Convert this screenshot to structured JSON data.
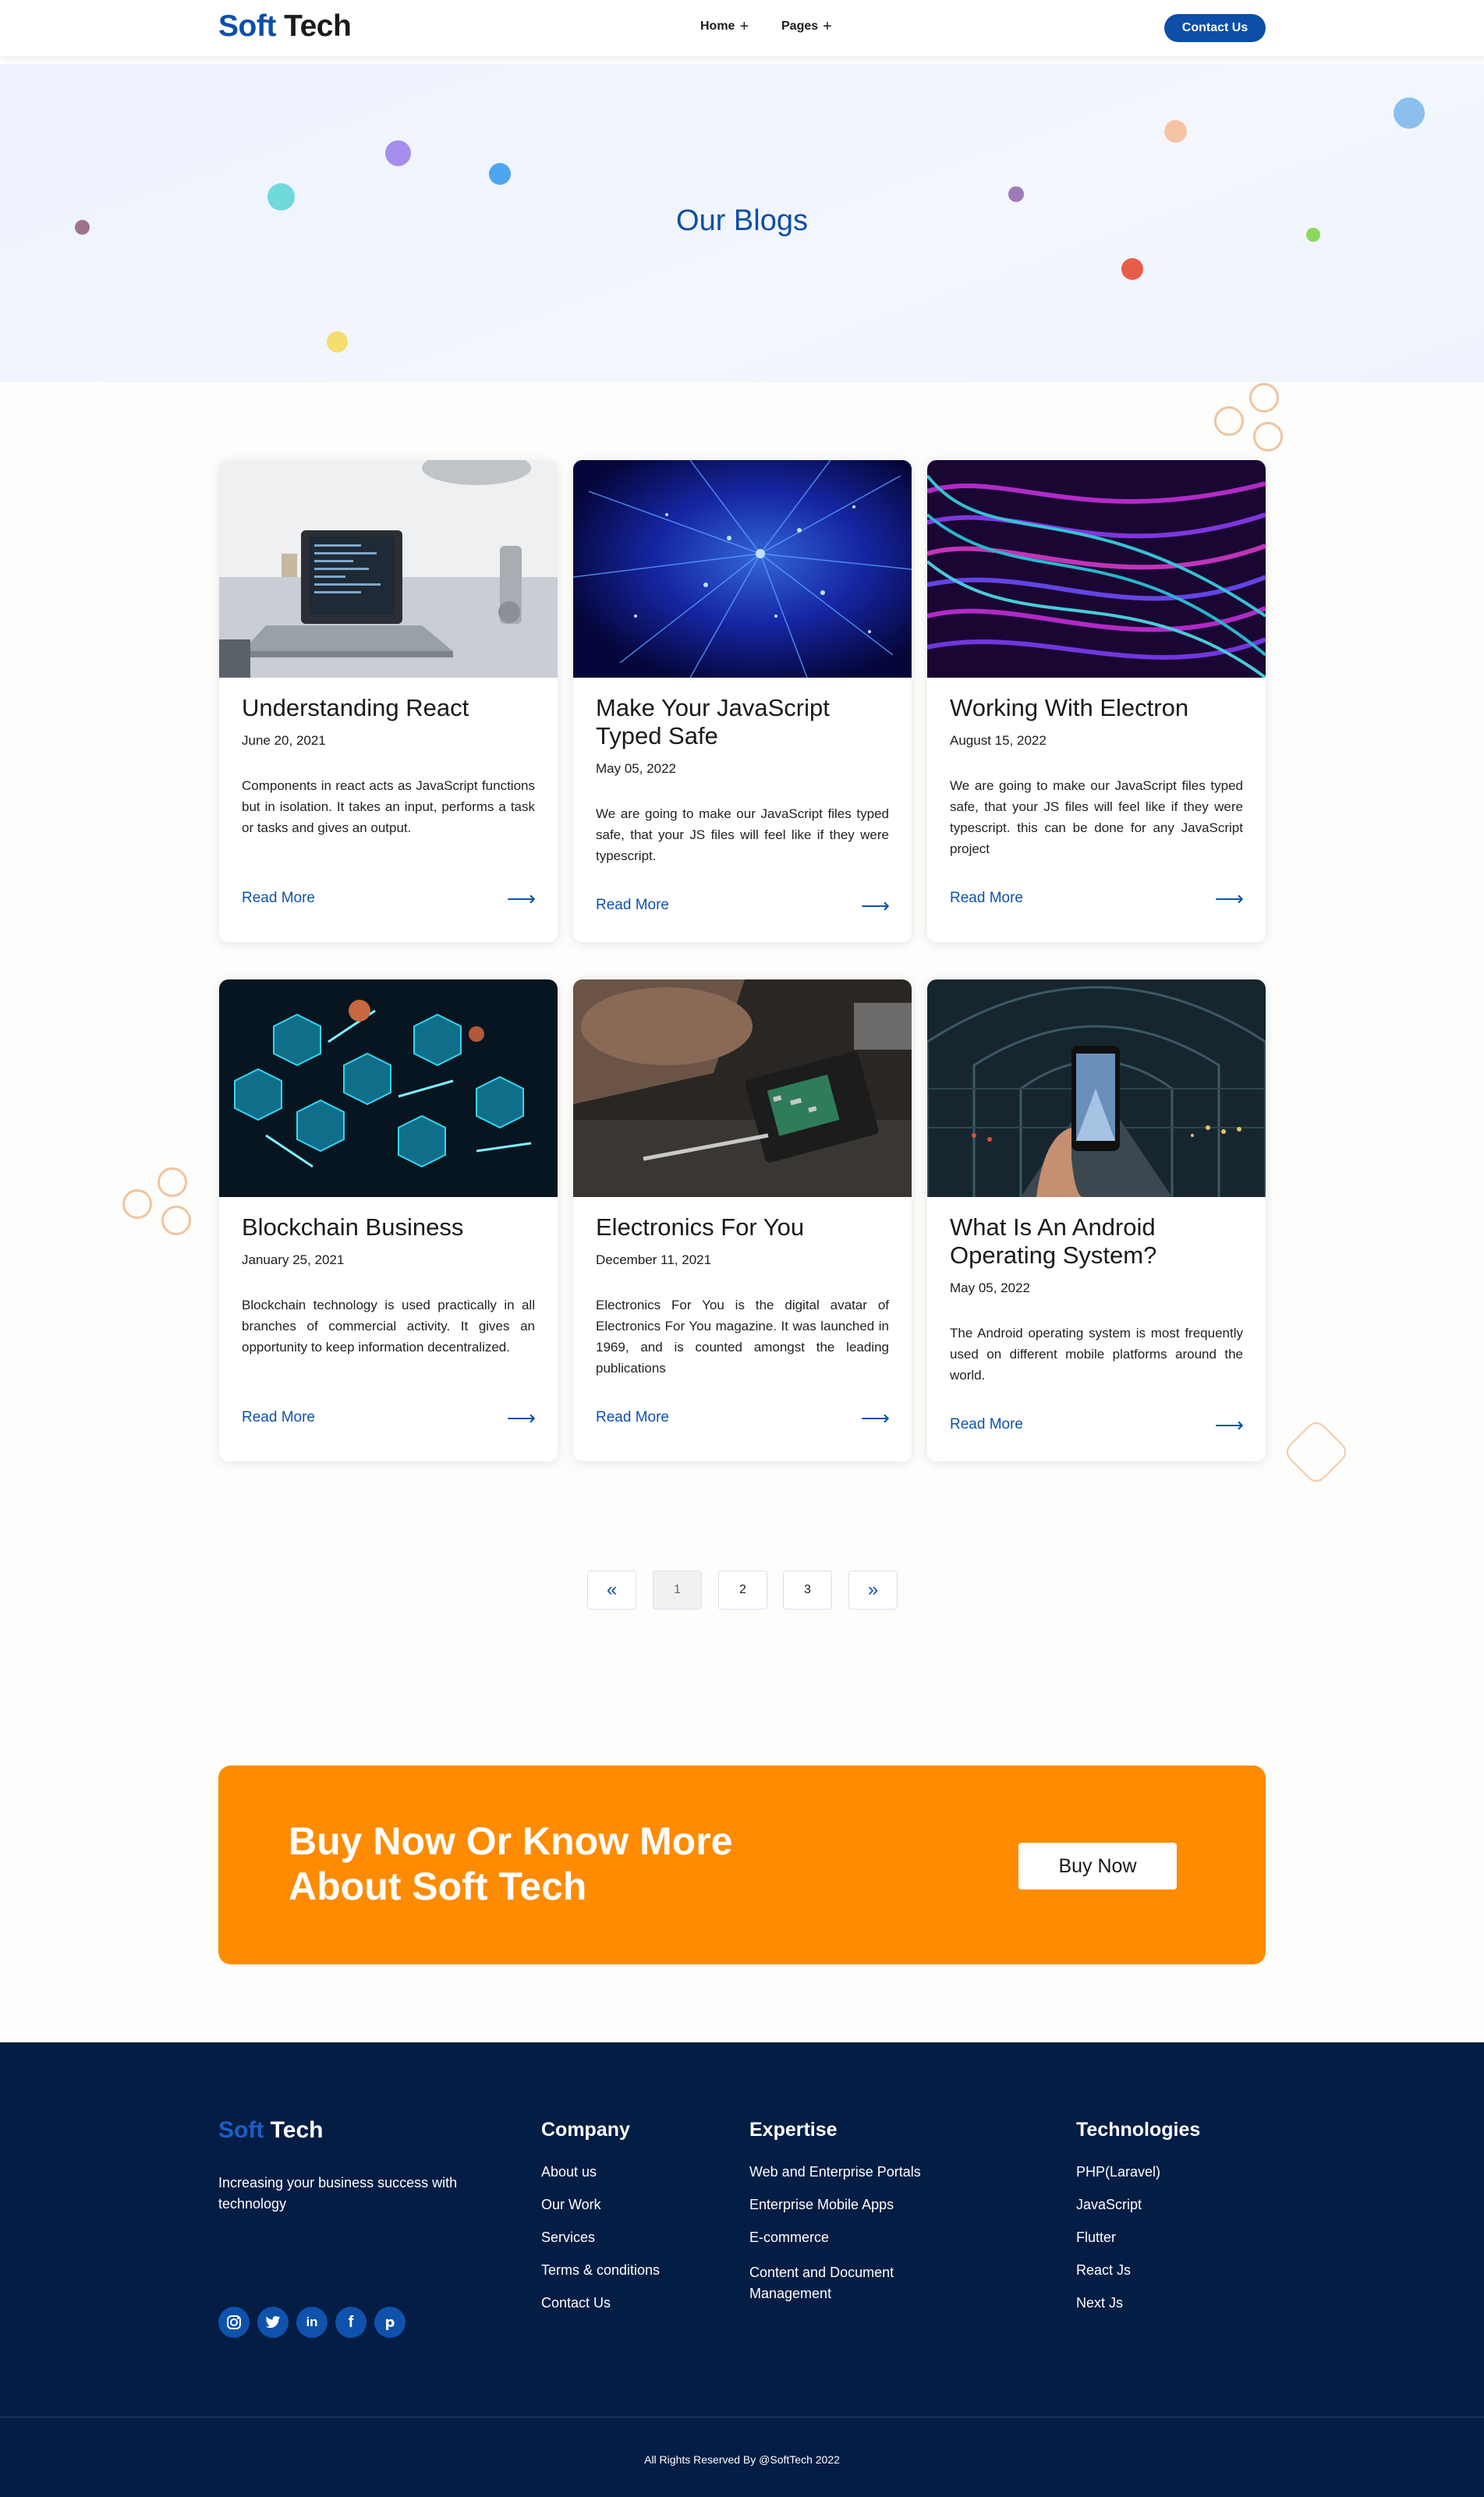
{
  "header": {
    "logo_part1": "Soft",
    "logo_part2": "Tech",
    "nav": [
      {
        "label": "Home",
        "icon": "plus-icon"
      },
      {
        "label": "Pages",
        "icon": "plus-icon"
      }
    ],
    "cta_label": "Contact Us"
  },
  "hero": {
    "title": "Our Blogs"
  },
  "blogs": [
    {
      "title": "Understanding React",
      "date": "June 20, 2021",
      "description": "Components in react acts as JavaScript functions but in isolation. It takes an input, performs a task or tasks and gives an output.",
      "read_more": "Read More"
    },
    {
      "title": "Make Your JavaScript Typed Safe",
      "date": "May 05, 2022",
      "description": "We are going to make our JavaScript files typed safe, that your JS files will feel like if they were typescript.",
      "read_more": "Read More"
    },
    {
      "title": "Working With Electron",
      "date": "August 15, 2022",
      "description": "We are going to make our JavaScript files typed safe, that your JS files will feel like if they were typescript. this can be done for any JavaScript project",
      "read_more": "Read More"
    },
    {
      "title": "Blockchain Business",
      "date": "January 25, 2021",
      "description": "Blockchain technology is used practically in all branches of commercial activity. It gives an opportunity to keep information decentralized.",
      "read_more": "Read More"
    },
    {
      "title": "Electronics For You",
      "date": "December 11, 2021",
      "description": "Electronics For You is the digital avatar of Electronics For You magazine. It was launched in 1969, and is counted amongst the leading publications",
      "read_more": "Read More"
    },
    {
      "title": "What Is An Android Operating System?",
      "date": "May 05, 2022",
      "description": "The Android operating system is most frequently used on different mobile platforms around the world.",
      "read_more": "Read More"
    }
  ],
  "pagination": {
    "first_icon": "double-chevron-left-icon",
    "pages": [
      "1",
      "2",
      "3"
    ],
    "current": "1",
    "last_icon": "double-chevron-right-icon"
  },
  "banner": {
    "heading": "Buy Now Or Know More About Soft Tech",
    "button": "Buy Now",
    "color": "#ff8b00"
  },
  "footer": {
    "logo_part1": "Soft",
    "logo_part2": "Tech",
    "tagline": "Increasing your business success with technology",
    "social": [
      "instagram-icon",
      "twitter-icon",
      "linkedin-icon",
      "facebook-icon",
      "pinterest-icon"
    ],
    "company": {
      "heading": "Company",
      "links": [
        "About us",
        "Our Work",
        "Services",
        "Terms & conditions",
        "Contact Us"
      ]
    },
    "expertise": {
      "heading": "Expertise",
      "links": [
        "Web and Enterprise Portals",
        "Enterprise Mobile Apps",
        "E-commerce",
        "Content and Document Management"
      ]
    },
    "technologies": {
      "heading": "Technologies",
      "links": [
        "PHP(Laravel)",
        "JavaScript",
        "Flutter",
        "React Js",
        "Next Js"
      ]
    },
    "copyright": "All Rights Reserved By @SoftTech 2022"
  },
  "colors": {
    "brand": "#0e4fa8",
    "footer_bg": "#041d44",
    "accent_orange": "#ff8b00"
  }
}
